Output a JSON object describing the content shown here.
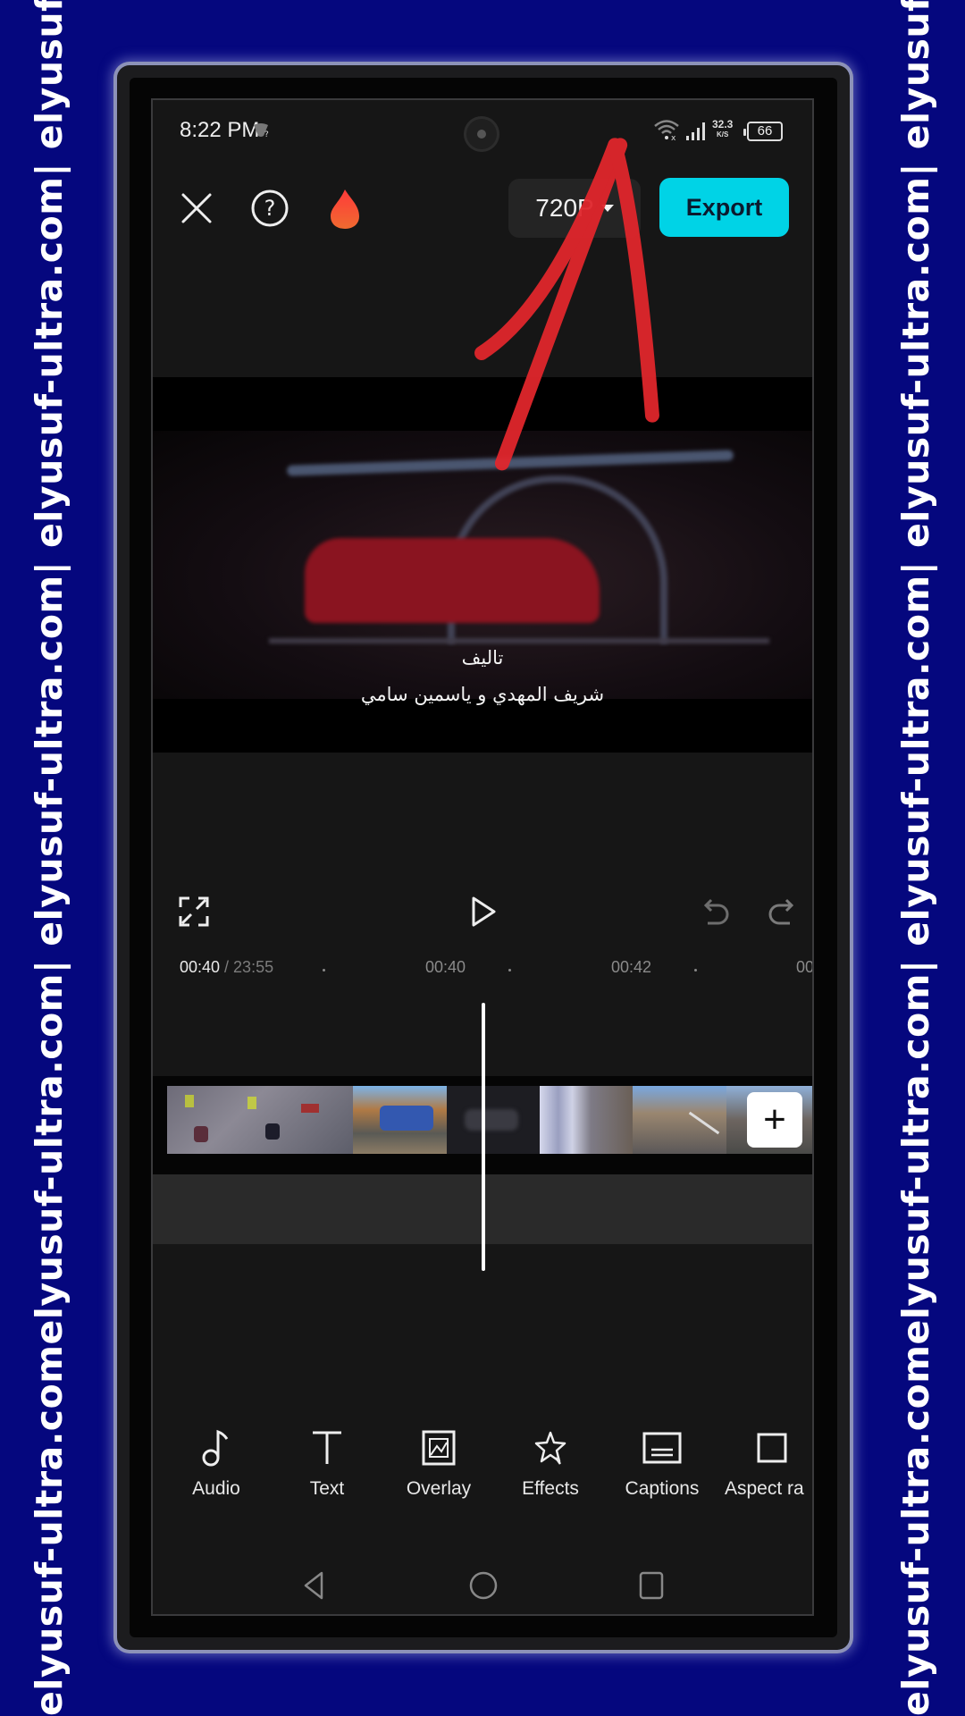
{
  "watermark": {
    "left_text": "elyusuf-ultra.comelyusuf-ultra.com| elyusuf-ultra.com| elyusuf-ultra.com| elyusuf-ultra.",
    "right_text": "elyusuf-ultra.comelyusuf-ultra.com| elyusuf-ultra.com| elyusuf-ultra.com| elyusuf-ultra."
  },
  "status_bar": {
    "time": "8:22 PM",
    "net_speed_value": "32.3",
    "net_speed_unit": "K/S",
    "battery": "66"
  },
  "top_bar": {
    "close_icon": "close-icon",
    "help_icon": "help-icon",
    "pro_icon": "flame-icon",
    "resolution": "720P",
    "export_label": "Export",
    "export_color": "#00d3e6"
  },
  "preview": {
    "subtitle_line1": "تاليف",
    "subtitle_line2": "شريف المهدي و ياسمين سامي",
    "annotation": "red-arrow-pointing-to-export"
  },
  "playback": {
    "fullscreen_icon": "fullscreen-icon",
    "play_icon": "play-icon",
    "undo_icon": "undo-icon",
    "redo_icon": "redo-icon"
  },
  "timeline": {
    "current_time": "00:40",
    "total_time": " / 23:55",
    "ticks": [
      "00:40",
      "00:42",
      "00"
    ],
    "add_clip_label": "+"
  },
  "toolbar": {
    "items": [
      {
        "label": "Audio",
        "icon": "music-note-icon"
      },
      {
        "label": "Text",
        "icon": "text-icon"
      },
      {
        "label": "Overlay",
        "icon": "overlay-icon"
      },
      {
        "label": "Effects",
        "icon": "effects-star-icon"
      },
      {
        "label": "Captions",
        "icon": "captions-icon"
      },
      {
        "label": "Aspect ra",
        "icon": "aspect-ratio-icon"
      }
    ]
  },
  "nav_bar": {
    "back": "back-icon",
    "home": "home-icon",
    "recents": "recents-icon"
  }
}
